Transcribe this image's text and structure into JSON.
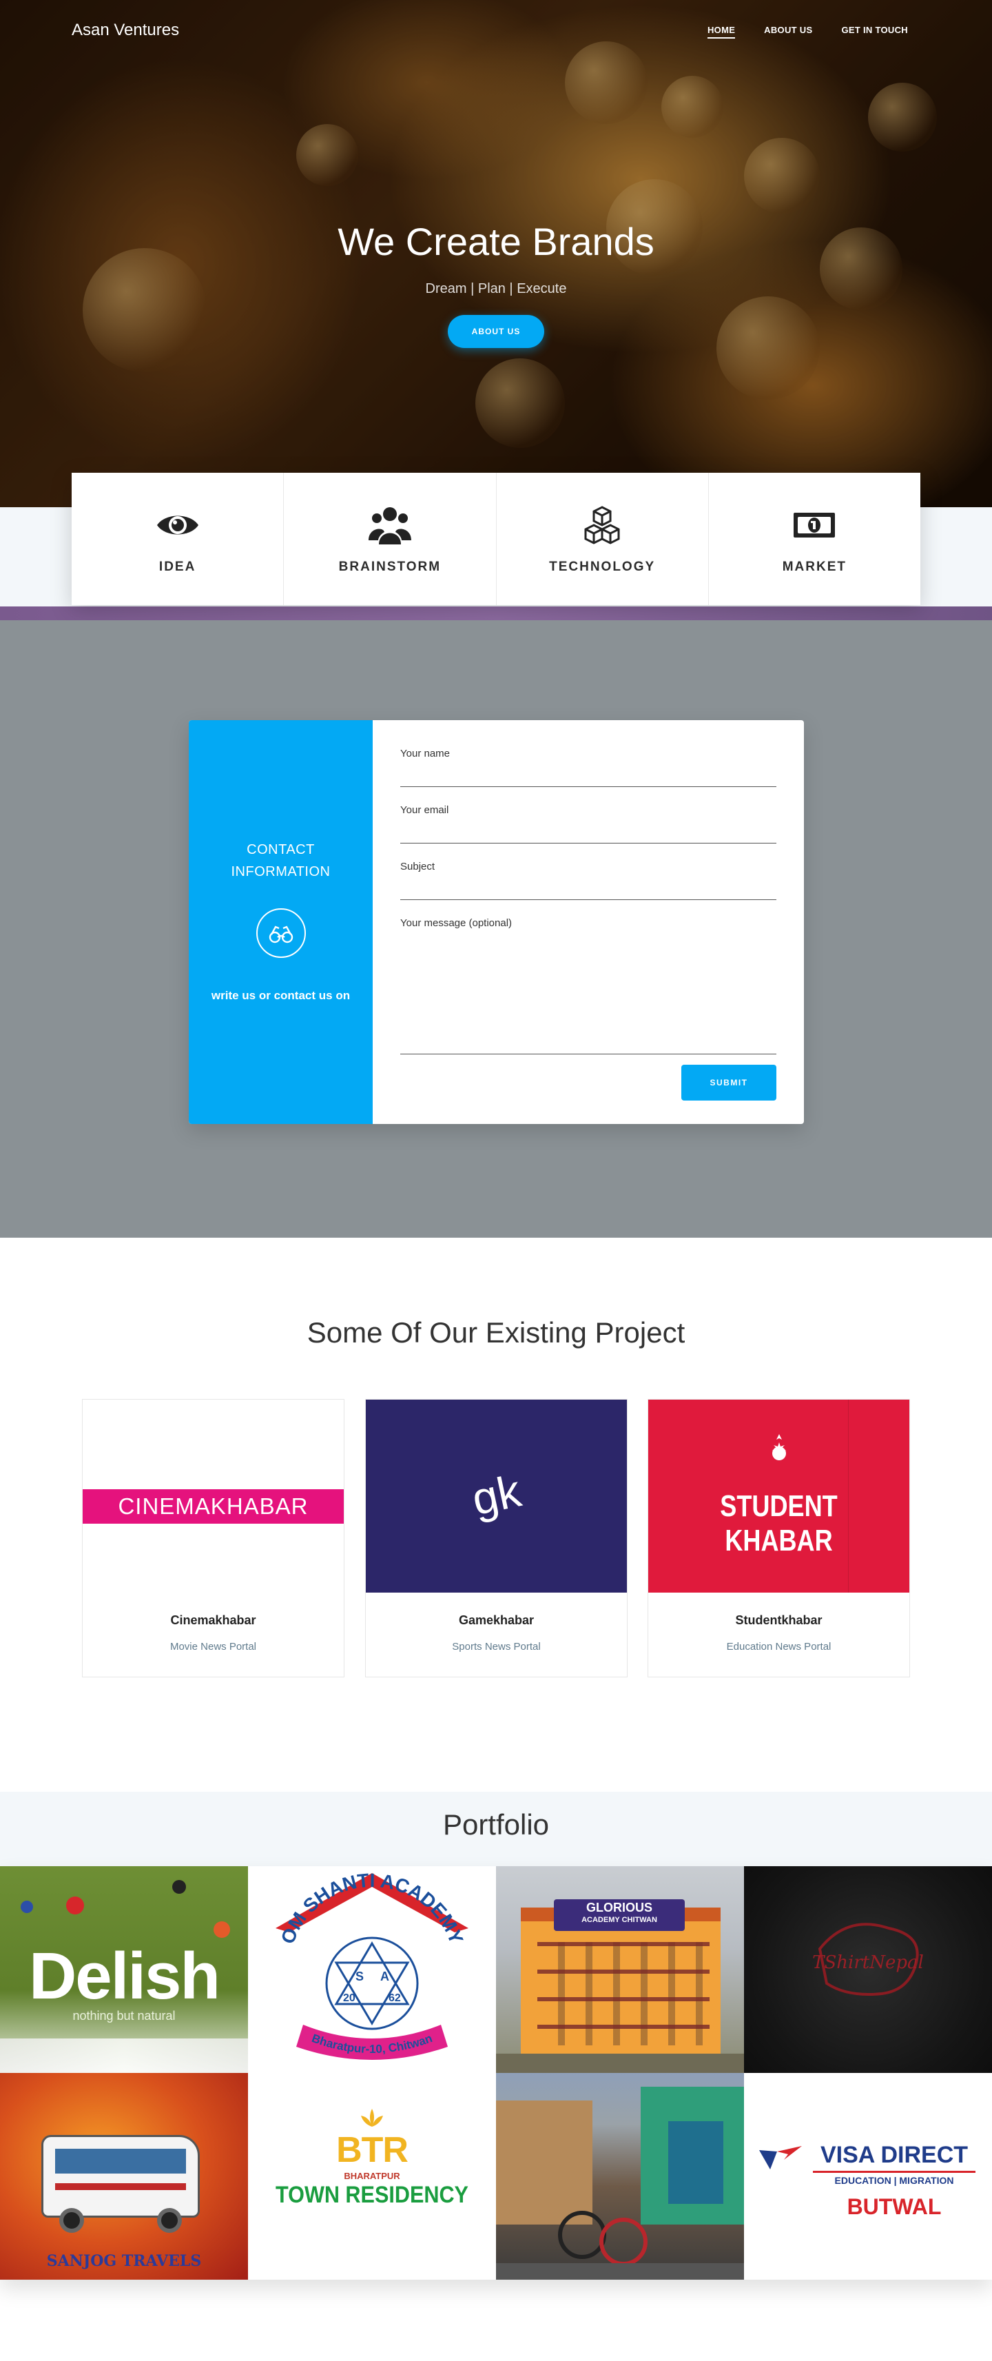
{
  "nav": {
    "brand": "Asan Ventures",
    "links": [
      "HOME",
      "ABOUT US",
      "GET IN TOUCH"
    ]
  },
  "hero": {
    "title": "We Create Brands",
    "subtitle": "Dream | Plan | Execute",
    "button": "ABOUT US"
  },
  "features": [
    {
      "label": "IDEA",
      "icon": "eye-icon"
    },
    {
      "label": "BRAINSTORM",
      "icon": "users-icon"
    },
    {
      "label": "TECHNOLOGY",
      "icon": "cubes-icon"
    },
    {
      "label": "MARKET",
      "icon": "money-icon"
    }
  ],
  "contact": {
    "title": "CONTACT INFORMATION",
    "note": "write us or contact us on",
    "icon": "binoculars-icon",
    "fields": [
      "Your name",
      "Your email",
      "Subject",
      "Your message (optional)"
    ],
    "submit": "SUBMIT"
  },
  "projects": {
    "title": "Some Of Our Existing Project",
    "items": [
      {
        "name": "Cinemakhabar",
        "desc": "Movie News Portal",
        "logo": "CINEMAKHABAR"
      },
      {
        "name": "Gamekhabar",
        "desc": "Sports News Portal",
        "logo": "gk"
      },
      {
        "name": "Studentkhabar",
        "desc": "Education News Portal",
        "logo_line1": "STUDENT",
        "logo_line2": "KHABAR"
      }
    ]
  },
  "portfolio": {
    "title": "Portfolio",
    "tiles": {
      "delish": {
        "name": "Delish",
        "tagline": "nothing but natural"
      },
      "omshanti": {
        "name": "OM SHANTI ACADEMY",
        "place": "Bharatpur-10, Chitwan",
        "year_left": "20",
        "year_right": "62",
        "letters": [
          "S",
          "A"
        ]
      },
      "glorious": {
        "name": "GLORIOUS",
        "subtitle": "ACADEMY CHITWAN"
      },
      "tshirt": {
        "name": "TShirtNepal"
      },
      "sanjog": {
        "name": "SANJOG TRAVELS"
      },
      "btr": {
        "letters": "BTR",
        "place": "BHARATPUR",
        "name": "TOWN RESIDENCY"
      },
      "visa": {
        "name": "VISA DIRECT",
        "tagline": "EDUCATION | MIGRATION",
        "city": "BUTWAL"
      }
    }
  },
  "colors": {
    "accent": "#03a9f4",
    "contact_bg": "#8a9195",
    "cinemakhabar": "#e5127d",
    "gamekhabar": "#2c2669",
    "studentkhabar": "#e01a3c"
  }
}
